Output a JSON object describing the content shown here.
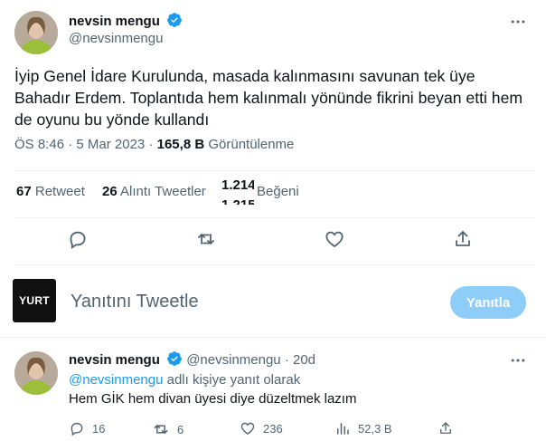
{
  "main_tweet": {
    "author_name": "nevsin mengu",
    "author_handle": "@nevsinmengu",
    "text": "İyip Genel İdare Kurulunda, masada kalınmasını savunan tek üyе Bahadır Erdem. Toplantıda hem kalınmalı yönünde fikrini beyan etti hem de oyunu bu yönde kullandı",
    "time": "ÖS 8:46",
    "date": "5 Mar 2023",
    "views": "165,8 B",
    "views_label": "Görüntülenme",
    "retweets": "67",
    "retweets_label": "Retweet",
    "quotes": "26",
    "quotes_label": "Alıntı Tweetler",
    "likes_old": "1.214",
    "likes_new": "1.215",
    "likes_label": "Beğeni"
  },
  "compose": {
    "avatar_text": "YURT",
    "placeholder": "Yanıtını Tweetle",
    "button_label": "Yanıtla"
  },
  "reply_tweet": {
    "author_name": "nevsin mengu",
    "author_handle": "@nevsinmengu",
    "age": "· 20d",
    "reply_to_handle": "@nevsinmengu",
    "reply_to_suffix": " adlı kişiye yanıt olarak",
    "text": "Hem GİK hem divan üyesi diye düzeltmek lazım",
    "replies": "16",
    "retweets": "6",
    "likes": "236",
    "views": "52,3 B"
  },
  "colors": {
    "verified": "#1d9bf0",
    "muted": "#536471",
    "link": "#1d9bf0",
    "button_disabled": "#8ecdf8"
  }
}
